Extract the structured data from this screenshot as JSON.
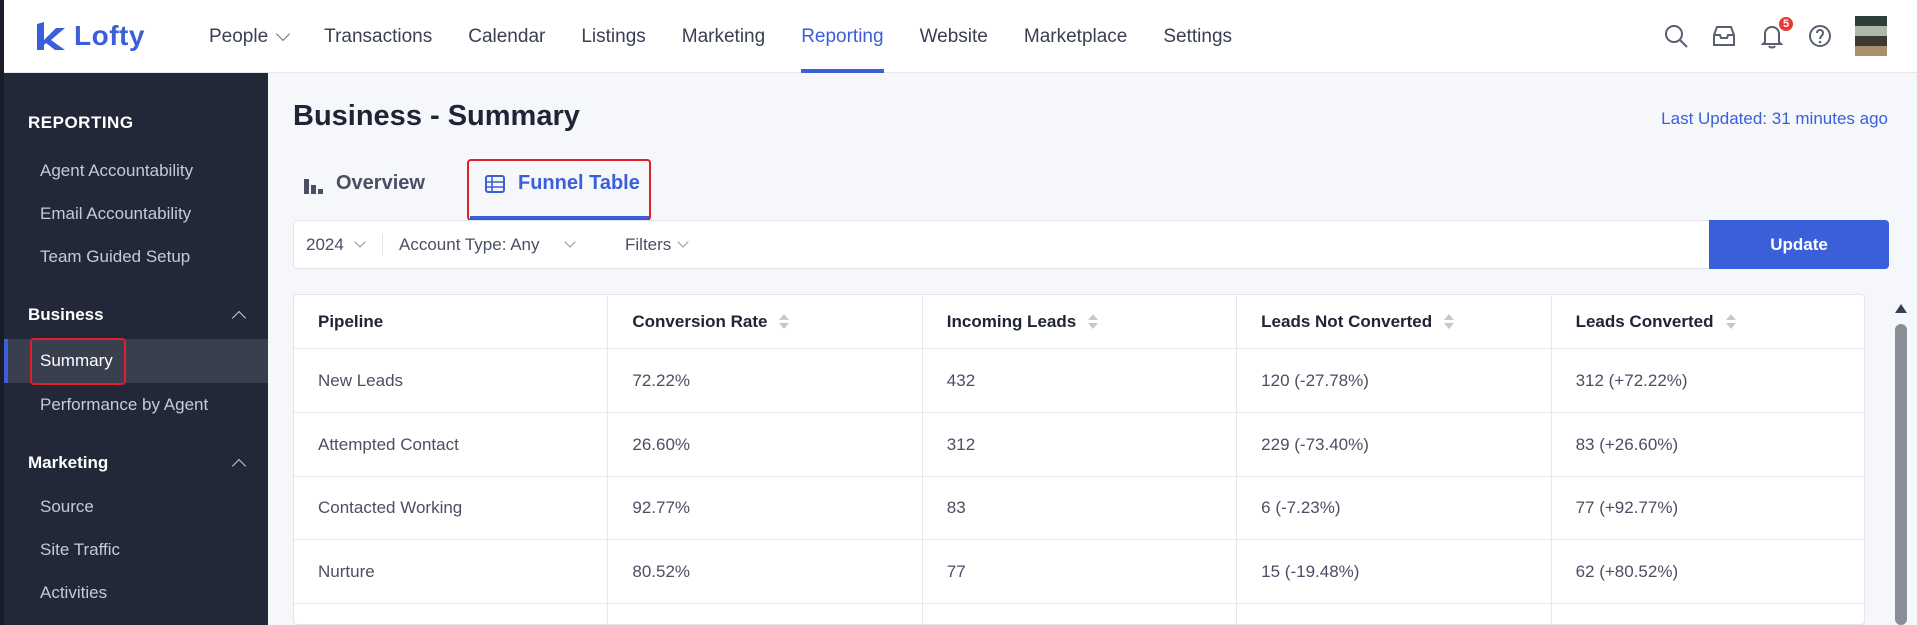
{
  "brand": {
    "name": "Lofty",
    "color": "#3a5fd9"
  },
  "nav": {
    "items": [
      {
        "label": "People",
        "has_dropdown": true
      },
      {
        "label": "Transactions"
      },
      {
        "label": "Calendar"
      },
      {
        "label": "Listings"
      },
      {
        "label": "Marketing"
      },
      {
        "label": "Reporting",
        "active": true
      },
      {
        "label": "Website"
      },
      {
        "label": "Marketplace"
      },
      {
        "label": "Settings"
      }
    ],
    "notification_count": "5"
  },
  "sidebar": {
    "heading": "REPORTING",
    "top_items": [
      "Agent Accountability",
      "Email Accountability",
      "Team Guided Setup"
    ],
    "business": {
      "label": "Business",
      "items": [
        "Summary",
        "Performance by Agent"
      ],
      "active": "Summary"
    },
    "marketing": {
      "label": "Marketing",
      "items": [
        "Source",
        "Site Traffic",
        "Activities"
      ]
    }
  },
  "page": {
    "title": "Business - Summary",
    "last_updated": "Last Updated: 31 minutes ago",
    "tabs": [
      {
        "label": "Overview",
        "icon": "bar-chart-icon"
      },
      {
        "label": "Funnel Table",
        "icon": "table-icon",
        "active": true
      }
    ]
  },
  "filters": {
    "year": "2024",
    "account_type": "Account Type: Any",
    "filters_label": "Filters",
    "update_label": "Update"
  },
  "table": {
    "columns": [
      "Pipeline",
      "Conversion Rate",
      "Incoming Leads",
      "Leads Not Converted",
      "Leads Converted"
    ],
    "rows": [
      [
        "New Leads",
        "72.22%",
        "432",
        "120 (-27.78%)",
        "312 (+72.22%)"
      ],
      [
        "Attempted Contact",
        "26.60%",
        "312",
        "229 (-73.40%)",
        "83 (+26.60%)"
      ],
      [
        "Contacted Working",
        "92.77%",
        "83",
        "6 (-7.23%)",
        "77 (+92.77%)"
      ],
      [
        "Nurture",
        "80.52%",
        "77",
        "15 (-19.48%)",
        "62 (+80.52%)"
      ]
    ]
  }
}
